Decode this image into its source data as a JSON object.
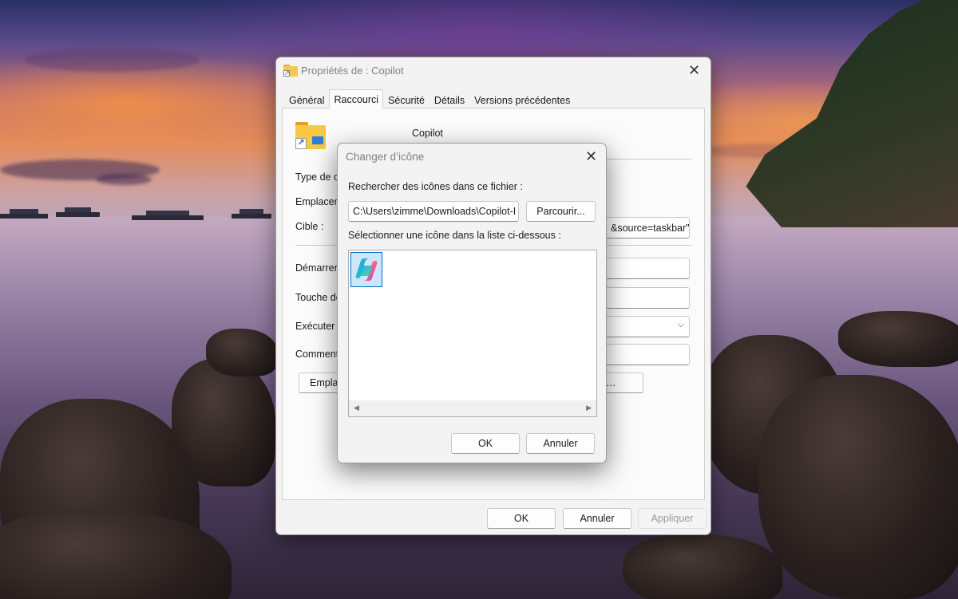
{
  "properties_window": {
    "title": "Propriétés de : Copilot",
    "tabs": [
      "Général",
      "Raccourci",
      "Sécurité",
      "Détails",
      "Versions précédentes"
    ],
    "active_tab": "Raccourci",
    "shortcut_name": "Copilot",
    "labels": {
      "type": "Type de ci",
      "location": "Emplacem",
      "target": "Cible :",
      "start_in": "Démarrer",
      "shortcut_key": "Touche de",
      "run": "Exécuter :",
      "comment": "Comment"
    },
    "target_value_visible": "&source=taskbar\"",
    "open_location_button": "Empla",
    "change_icon_button_tail": "…",
    "buttons": {
      "ok": "OK",
      "cancel": "Annuler",
      "apply": "Appliquer"
    }
  },
  "change_icon_dialog": {
    "title": "Changer d’icône",
    "search_label": "Rechercher des icônes dans ce fichier :",
    "file_path": "C:\\Users\\zimme\\Downloads\\Copilot-I",
    "browse_button": "Parcourir...",
    "select_label": "Sélectionner une icône dans la liste ci-dessous :",
    "icons": [
      {
        "name": "copilot-icon",
        "selected": true
      }
    ],
    "buttons": {
      "ok": "OK",
      "cancel": "Annuler"
    }
  }
}
